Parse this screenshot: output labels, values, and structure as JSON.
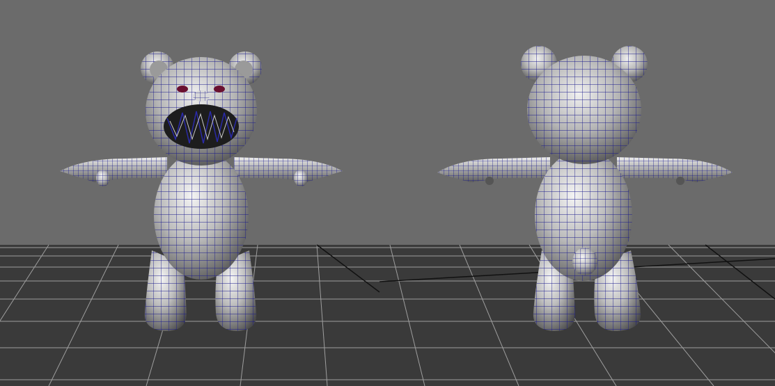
{
  "viewport": {
    "background_color": "#6b6b6b",
    "ground_color": "#3a3a3a",
    "grid_color": "#b0b0b0",
    "grid_axis_color": "#111111"
  },
  "models": [
    {
      "name": "teddy-bear-front",
      "view": "front",
      "wire_color": "#1a1a8c"
    },
    {
      "name": "teddy-bear-back",
      "view": "back",
      "wire_color": "#1a1a8c"
    }
  ]
}
